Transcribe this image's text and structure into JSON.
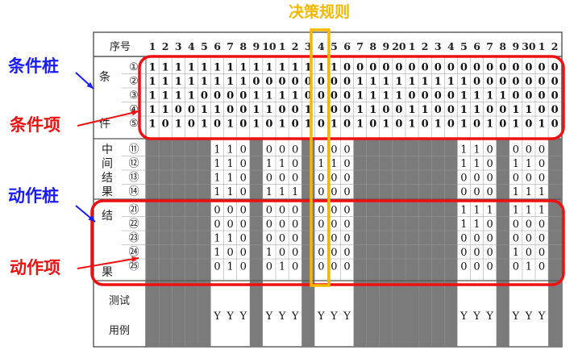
{
  "colors": {
    "annot_blue": "#1a1aff",
    "annot_red": "#ee1111",
    "highlight": "#f5b800",
    "shade": "#7b7b7b",
    "grid": "#555555",
    "box_red": "#ee1111"
  },
  "annotations": {
    "rule_label": "决策规则",
    "condition_stub": "条件桩",
    "condition_entry": "条件项",
    "action_stub": "动作桩",
    "action_entry": "动作项"
  },
  "table": {
    "seq_header": "序号",
    "rule_numbers": [
      "1",
      "2",
      "3",
      "4",
      "5",
      "6",
      "7",
      "8",
      "9",
      "10",
      "1",
      "2",
      "3",
      "4",
      "5",
      "6",
      "7",
      "8",
      "9",
      "20",
      "1",
      "2",
      "3",
      "4",
      "5",
      "6",
      "7",
      "8",
      "9",
      "30",
      "1",
      "2"
    ],
    "condition_group_label": "条件",
    "condition_ids": [
      "①",
      "②",
      "③",
      "④",
      "⑤"
    ],
    "conditions": [
      "11111111111111100000000000000000",
      "11111111000000001111111110000000",
      "11110000111100001111000011110000",
      "11001100110011001100110011001100",
      "10101010101010101010101010101010"
    ],
    "intermediate_group_label": "中间结果",
    "intermediate_ids": [
      "⑪",
      "⑫",
      "⑬",
      "⑭"
    ],
    "intermediate": [
      "------110-000-000-------110-000-000",
      "------110-110-110-------110-110-110",
      "------110-000-000-------000-000-000",
      "------110-111-000-------000-111-000"
    ],
    "result_group_label": "结果",
    "result_ids": [
      "㉑",
      "㉒",
      "㉓",
      "㉔",
      "㉕"
    ],
    "results": [
      "------000-000-000-------111-111-111",
      "------000-000-000-------110-000-000",
      "------110-000-000-------000-000-000",
      "------100-100-000-------000-100-000",
      "------010-010-000-------000-010-000"
    ],
    "testcase_label_1": "测试",
    "testcase_label_2": "用例",
    "testcases": "------YYY-YYY-YY--------YYY-YYY-YY"
  }
}
